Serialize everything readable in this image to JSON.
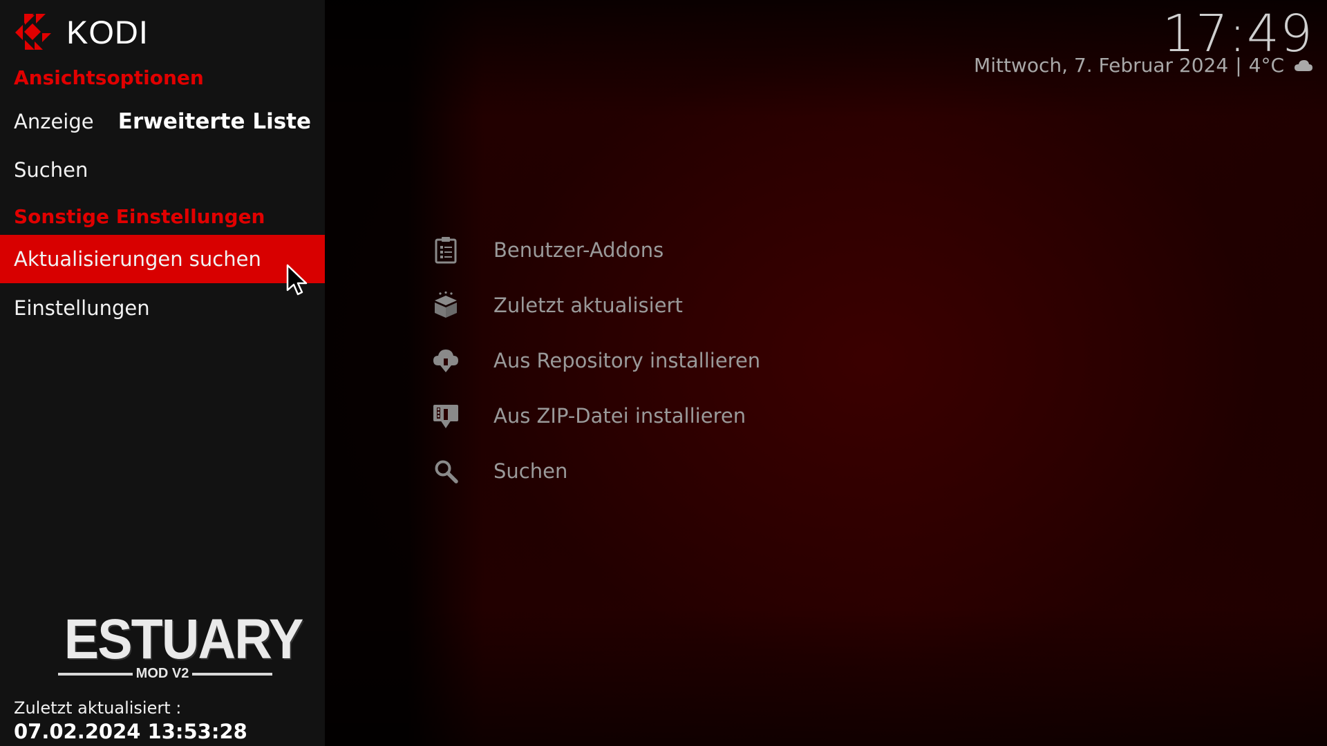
{
  "app": {
    "logo_text": "KODI"
  },
  "sidebar": {
    "view_options_header": "Ansichtsoptionen",
    "display_label": "Anzeige",
    "display_value": "Erweiterte Liste",
    "search_label": "Suchen",
    "other_settings_header": "Sonstige Einstellungen",
    "check_updates_label": "Aktualisierungen suchen",
    "settings_label": "Einstellungen",
    "accent_color": "#d80000"
  },
  "skin_logo": {
    "title": "ESTUARY",
    "subtitle": "MOD V2"
  },
  "footer": {
    "last_updated_label": "Zuletzt aktualisiert :",
    "last_updated_value": "07.02.2024 13:53:28"
  },
  "header": {
    "time": "17:49",
    "date": "Mittwoch, 7. Februar 2024",
    "separator": "|",
    "temperature": "4°C",
    "weather_icon": "cloud-icon"
  },
  "addon_menu": {
    "items": [
      {
        "label": "Benutzer-Addons",
        "icon": "clipboard-icon"
      },
      {
        "label": "Zuletzt aktualisiert",
        "icon": "box-icon"
      },
      {
        "label": "Aus Repository installieren",
        "icon": "cloud-download-icon"
      },
      {
        "label": "Aus ZIP-Datei installieren",
        "icon": "zip-install-icon"
      },
      {
        "label": "Suchen",
        "icon": "search-icon"
      }
    ]
  }
}
